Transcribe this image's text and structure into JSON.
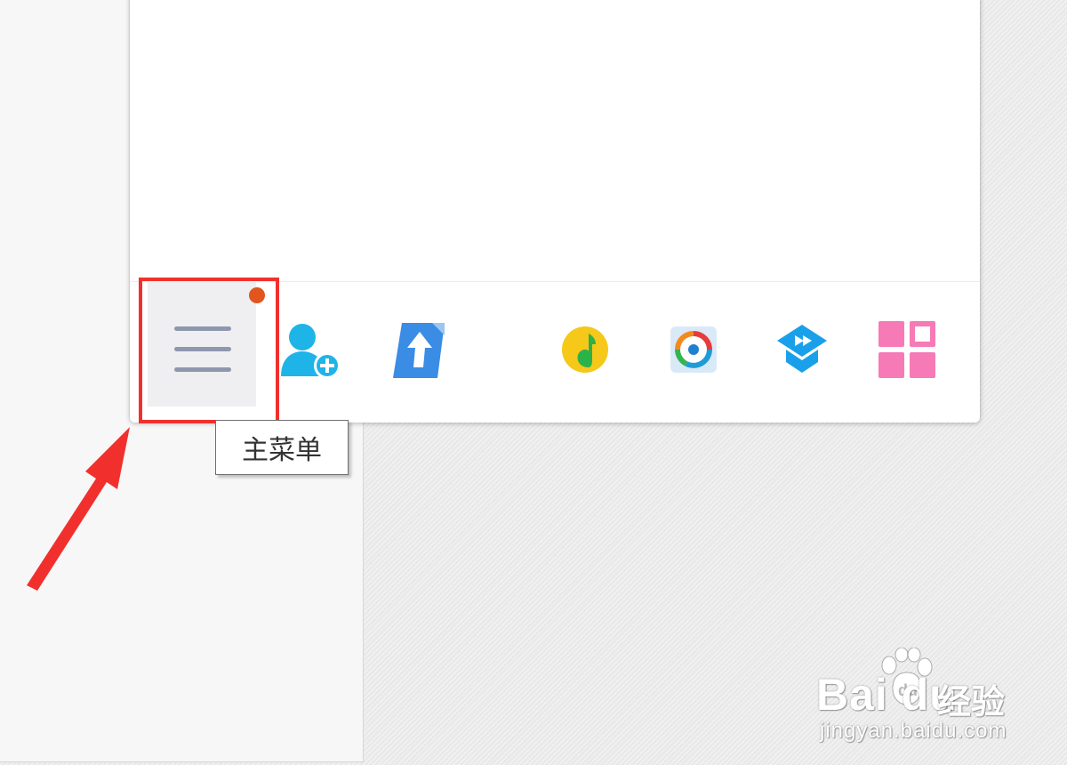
{
  "window": {
    "toolbar": {
      "main_menu_tooltip": "主菜单",
      "notification_dot_color": "#e0561d",
      "icons": [
        {
          "name": "main-menu-icon",
          "label": "主菜单"
        },
        {
          "name": "add-contact-icon"
        },
        {
          "name": "transfer-upload-icon"
        },
        {
          "name": "qq-music-icon"
        },
        {
          "name": "tencent-video-icon"
        },
        {
          "name": "tencent-classroom-icon"
        },
        {
          "name": "app-manager-icon"
        }
      ]
    }
  },
  "annotation": {
    "highlight_color": "#f1302d",
    "arrow_color": "#f1302d"
  },
  "watermark": {
    "brand": "Bai  du",
    "brand_cn": "经验",
    "url": "jingyan.baidu.com"
  }
}
